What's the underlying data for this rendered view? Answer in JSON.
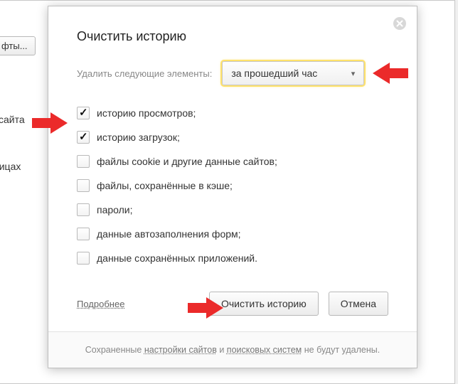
{
  "background": {
    "button_fragment": "фты...",
    "link1_fragment": "і сайта",
    "link2_fragment": "ницах"
  },
  "modal": {
    "title": "Очистить историю",
    "range_label": "Удалить следующие элементы:",
    "range_value": "за прошедший час",
    "checks": [
      {
        "label": "историю просмотров;",
        "checked": true
      },
      {
        "label": "историю загрузок;",
        "checked": true
      },
      {
        "label": "файлы cookie и другие данные сайтов;",
        "checked": false
      },
      {
        "label": "файлы, сохранённые в кэше;",
        "checked": false
      },
      {
        "label": "пароли;",
        "checked": false
      },
      {
        "label": "данные автозаполнения форм;",
        "checked": false
      },
      {
        "label": "данные сохранённых приложений.",
        "checked": false
      }
    ],
    "details": "Подробнее",
    "clear_button": "Очистить историю",
    "cancel_button": "Отмена",
    "footer_pre": "Сохраненные ",
    "footer_link1": "настройки сайтов",
    "footer_mid": " и ",
    "footer_link2": "поисковых систем",
    "footer_post": " не будут удалены."
  },
  "colors": {
    "arrow": "#eb2a2a",
    "glow": "#ffe26b"
  }
}
